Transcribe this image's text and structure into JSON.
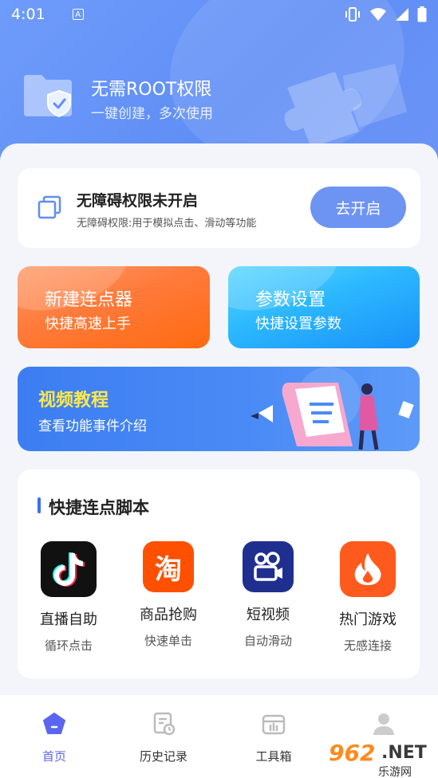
{
  "status_bar": {
    "time": "4:01",
    "a_badge": "A"
  },
  "hero": {
    "title": "无需ROOT权限",
    "subtitle": "一键创建，多次使用"
  },
  "accessibility": {
    "title": "无障碍权限未开启",
    "description": "无障碍权限:用于模拟点击、滑动等功能",
    "button": "去开启"
  },
  "tiles": [
    {
      "title": "新建连点器",
      "subtitle": "快捷高速上手"
    },
    {
      "title": "参数设置",
      "subtitle": "快捷设置参数"
    }
  ],
  "video": {
    "title": "视频教程",
    "subtitle": "查看功能事件介绍"
  },
  "scripts": {
    "title": "快捷连点脚本",
    "apps": [
      {
        "name": "直播自助",
        "desc": "循环点击",
        "icon": "tiktok-icon"
      },
      {
        "name": "商品抢购",
        "desc": "快速单击",
        "icon": "taobao-icon",
        "glyph": "淘"
      },
      {
        "name": "短视频",
        "desc": "自动滑动",
        "icon": "kuaishou-icon"
      },
      {
        "name": "热门游戏",
        "desc": "无感连接",
        "icon": "flame-icon"
      }
    ]
  },
  "tabs": [
    {
      "label": "首页",
      "active": true
    },
    {
      "label": "历史记录",
      "active": false
    },
    {
      "label": "工具箱",
      "active": false
    },
    {
      "label": "",
      "active": false
    }
  ],
  "watermark": {
    "brand": "962",
    "suffix": ".NET",
    "caption": "乐游网"
  },
  "colors": {
    "accent": "#5b66f0",
    "hero": "#6f9cfb",
    "orange": "#ff7a3a",
    "cyan": "#2bb7ff",
    "video": "#4b8bf6",
    "video_title": "#ffe84a"
  }
}
